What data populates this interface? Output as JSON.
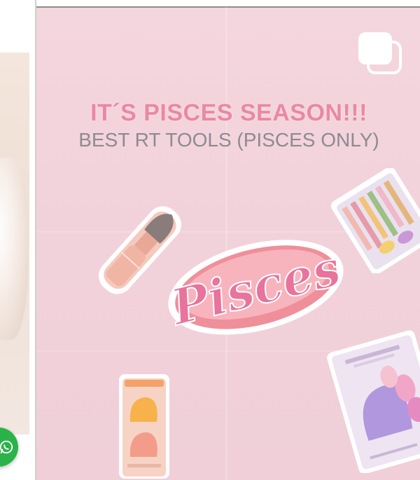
{
  "post": {
    "headline": "IT´S PISCES SEASON!!!",
    "subhead": "BEST RT TOOLS (PISCES ONLY)",
    "logo_text": "Pisces",
    "gallery_icon": "multiple-images-icon",
    "background_color": "#f2d2da",
    "headline_color": "#ea88a4"
  },
  "floating_button": {
    "icon": "whatsapp-icon",
    "color": "#2bb34a"
  }
}
